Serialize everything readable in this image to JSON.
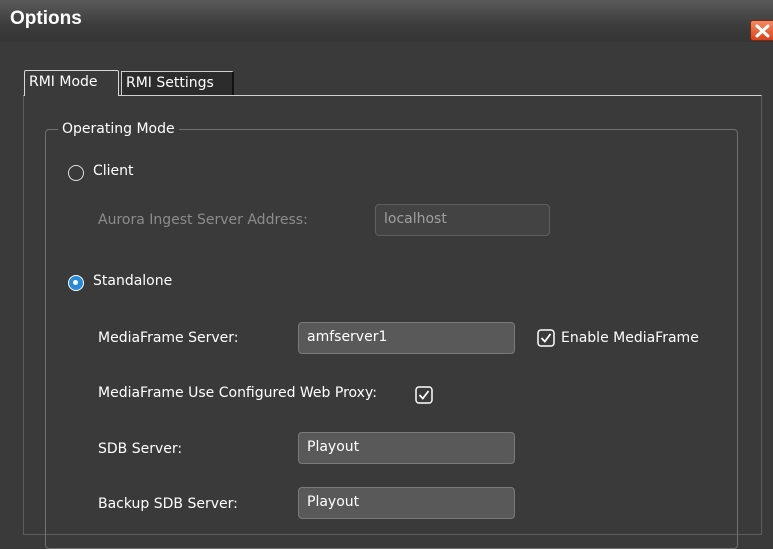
{
  "window": {
    "title": "Options",
    "close_icon": "close-icon"
  },
  "tabs": [
    {
      "label": "RMI Mode",
      "active": true
    },
    {
      "label": "RMI Settings",
      "active": false
    }
  ],
  "operating_mode": {
    "legend": "Operating Mode",
    "client": {
      "label": "Client",
      "selected": false,
      "server_address_label": "Aurora Ingest Server Address:",
      "server_address_value": "localhost"
    },
    "standalone": {
      "label": "Standalone",
      "selected": true,
      "mediaframe_server_label": "MediaFrame Server:",
      "mediaframe_server_value": "amfserver1",
      "enable_mediaframe_label": "Enable MediaFrame",
      "enable_mediaframe_checked": true,
      "web_proxy_label": "MediaFrame Use Configured Web Proxy:",
      "web_proxy_checked": true,
      "sdb_server_label": "SDB Server:",
      "sdb_server_value": "Playout",
      "backup_sdb_server_label": "Backup SDB Server:",
      "backup_sdb_server_value": "Playout"
    }
  },
  "colors": {
    "accent": "#2a8ad8",
    "close": "#d8431c",
    "background": "#3a3a3a"
  }
}
